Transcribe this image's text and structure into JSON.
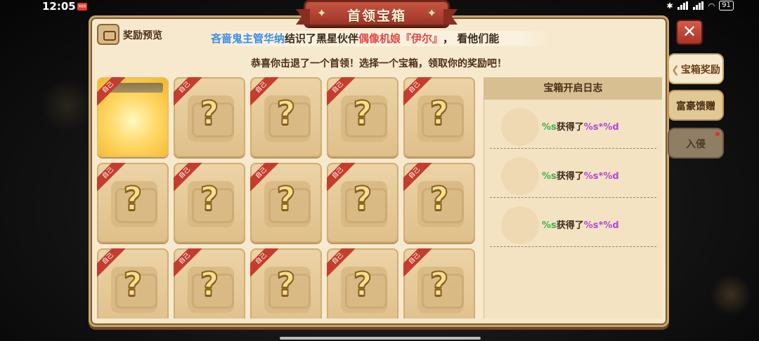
{
  "status": {
    "time": "12:05",
    "app_badge": "MIR",
    "battery": "91"
  },
  "panel": {
    "title": "首领宝箱",
    "preview_label": "奖励预览",
    "marquee": {
      "name": "吝啬鬼主管华纳",
      "verb": "结识了黑星伙伴",
      "partner": "偶像机娘『伊尔』",
      "tail": "，  看他们能"
    },
    "instruction": "恭喜你击退了一个首领！选择一个宝箱，领取你的奖励吧！",
    "chests": [
      {
        "tag": "自己",
        "opened": true
      },
      {
        "tag": "自己",
        "mark": "?"
      },
      {
        "tag": "自己",
        "mark": "?"
      },
      {
        "tag": "自己",
        "mark": "?"
      },
      {
        "tag": "自己",
        "mark": "?"
      },
      {
        "tag": "自己",
        "mark": "?"
      },
      {
        "tag": "自己",
        "mark": "?"
      },
      {
        "tag": "自己",
        "mark": "?"
      },
      {
        "tag": "自己",
        "mark": "?"
      },
      {
        "tag": "自己",
        "mark": "?"
      },
      {
        "tag": "自己",
        "mark": "?"
      },
      {
        "tag": "自己",
        "mark": "?"
      },
      {
        "tag": "自己",
        "mark": "?"
      },
      {
        "tag": "自己",
        "mark": "?"
      },
      {
        "tag": "自己",
        "mark": "?"
      }
    ],
    "log": {
      "title": "宝箱开启日志",
      "entries": [
        {
          "player": "%s",
          "verb": "获得了",
          "item": "%s*%d"
        },
        {
          "player": "%s",
          "verb": "获得了",
          "item": "%s*%d"
        },
        {
          "player": "%s",
          "verb": "获得了",
          "item": "%s*%d"
        }
      ]
    }
  },
  "close_label": "✕",
  "side_tabs": {
    "reward": "宝箱奖励",
    "gift": "富豪馈赠",
    "invade": "入侵"
  },
  "colors": {
    "accent_red": "#c53d2e",
    "panel_bg": "#f7e9cd",
    "log_green": "#3db24b",
    "log_purple": "#b048d8"
  }
}
